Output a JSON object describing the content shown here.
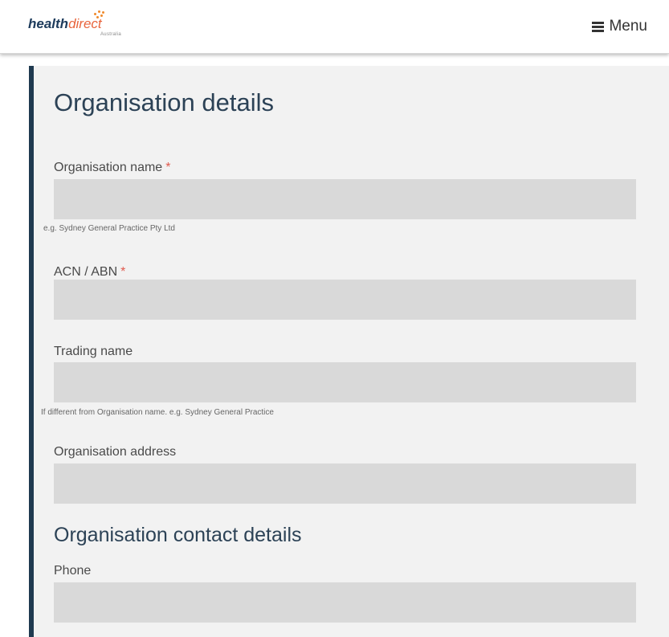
{
  "header": {
    "logo_health": "health",
    "logo_direct": "direct",
    "logo_sub": "Australia",
    "menu_label": "Menu"
  },
  "colors": {
    "accent_bar": "#1f3a50",
    "field_bg": "#d9d9d9",
    "required_star": "#e05a4e",
    "logo_orange": "#e8643c",
    "logo_navy": "#1d3b5c"
  },
  "form": {
    "title": "Organisation details",
    "fields": [
      {
        "label": "Organisation name",
        "required": "*",
        "value": "",
        "hint": "e.g. Sydney General Practice Pty Ltd"
      },
      {
        "label": "ACN / ABN",
        "required": "*",
        "value": "",
        "hint": ""
      },
      {
        "label": "Trading name",
        "required": "",
        "value": "",
        "hint": "If different from Organisation name. e.g. Sydney General Practice"
      },
      {
        "label": "Organisation address",
        "required": "",
        "value": "",
        "hint": ""
      }
    ],
    "contact_title": "Organisation contact details",
    "contact_fields": [
      {
        "label": "Phone",
        "value": ""
      }
    ]
  }
}
